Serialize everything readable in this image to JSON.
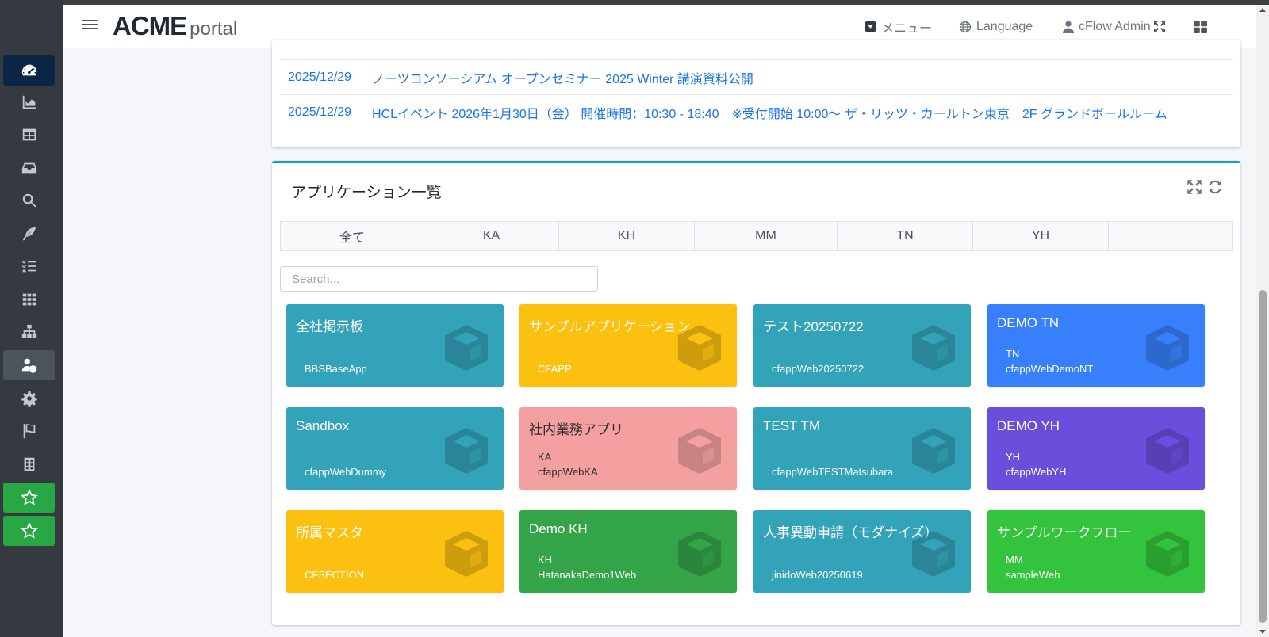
{
  "header": {
    "brand_main": "ACME",
    "brand_sub": "portal",
    "menu_label": "メニュー",
    "language_label": "Language",
    "user_label": "cFlow Admin"
  },
  "sidebar": {
    "items": [
      {
        "icon": "dashboard-icon"
      },
      {
        "icon": "chart-area-icon"
      },
      {
        "icon": "table-icon"
      },
      {
        "icon": "inbox-icon"
      },
      {
        "icon": "search-icon"
      },
      {
        "icon": "feather-icon"
      },
      {
        "icon": "tasks-icon"
      },
      {
        "icon": "grid-icon"
      },
      {
        "icon": "sitemap-icon"
      },
      {
        "icon": "user-shield-icon"
      },
      {
        "icon": "gear-icon"
      },
      {
        "icon": "flag-icon"
      },
      {
        "icon": "calculator-icon"
      },
      {
        "icon": "star-icon"
      },
      {
        "icon": "star-icon"
      }
    ]
  },
  "news": [
    {
      "date": "2025/12/29",
      "title": "ノーツコンソーシアム オープンセミナー 2025 Winter 講演資料公開"
    },
    {
      "date": "2025/12/29",
      "title": "HCLイベント 2026年1月30日（金） 開催時間：10:30 - 18:40　※受付開始 10:00〜 ザ・リッツ・カールトン東京　2F グランドボールルーム"
    }
  ],
  "apps": {
    "title": "アプリケーション一覧",
    "tabs": [
      "全て",
      "KA",
      "KH",
      "MM",
      "TN",
      "YH",
      ""
    ],
    "search_placeholder": "Search...",
    "tiles": [
      {
        "title": "全社掲示板",
        "lines": [
          "BBSBaseApp"
        ],
        "color": "#33a3b9"
      },
      {
        "title": "サンプルアプリケーション",
        "lines": [
          "CFAPP"
        ],
        "color": "#fbc010"
      },
      {
        "title": "テスト20250722",
        "lines": [
          "cfappWeb20250722"
        ],
        "color": "#33a3b9"
      },
      {
        "title": "DEMO TN",
        "lines": [
          "TN",
          "cfappWebDemoNT"
        ],
        "color": "#3880fb"
      },
      {
        "title": "Sandbox",
        "lines": [
          "cfappWebDummy"
        ],
        "color": "#33a3b9"
      },
      {
        "title": "社内業務アプリ",
        "lines": [
          "KA",
          "cfappWebKA"
        ],
        "color": "#f5a0a0"
      },
      {
        "title": "TEST TM",
        "lines": [
          "cfappWebTESTMatsubara"
        ],
        "color": "#33a3b9"
      },
      {
        "title": "DEMO YH",
        "lines": [
          "YH",
          "cfappWebYH"
        ],
        "color": "#6a4fdc"
      },
      {
        "title": "所属マスタ",
        "lines": [
          "CFSECTION"
        ],
        "color": "#fbc010"
      },
      {
        "title": "Demo KH",
        "lines": [
          "KH",
          "HatanakaDemo1Web"
        ],
        "color": "#33a448"
      },
      {
        "title": "人事異動申請（モダナイズ）",
        "lines": [
          "jinidoWeb20250619"
        ],
        "color": "#33a3b9"
      },
      {
        "title": "サンプルワークフロー",
        "lines": [
          "MM",
          "sampleWeb"
        ],
        "color": "#34c33c"
      }
    ]
  }
}
